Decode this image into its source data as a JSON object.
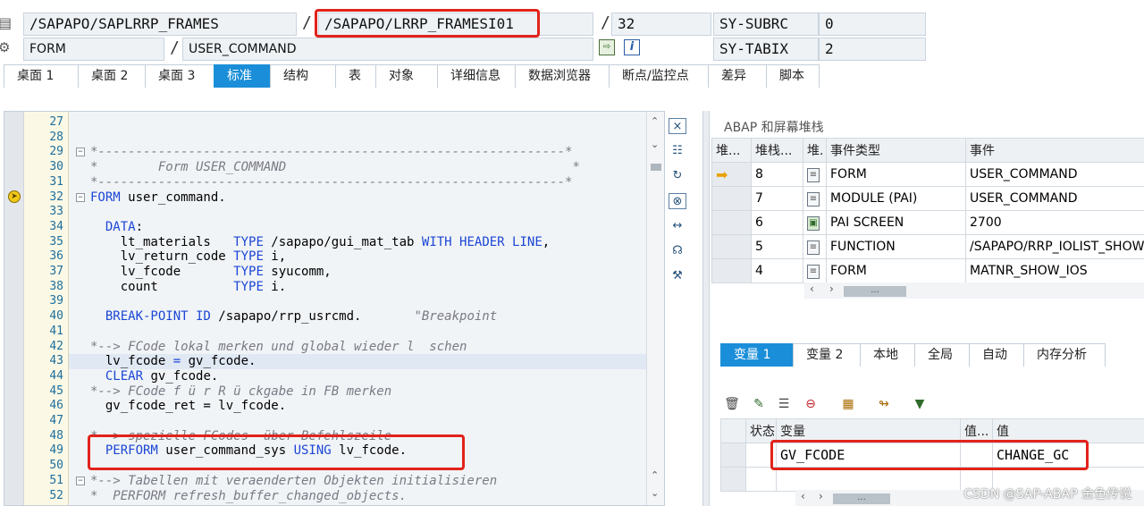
{
  "header": {
    "program": "/SAPAPO/SAPLRRP_FRAMES",
    "include": "/SAPAPO/LRRP_FRAMESI01",
    "line": "32",
    "subrc_label": "SY-SUBRC",
    "subrc_value": "0",
    "event_type": "FORM",
    "event": "USER_COMMAND",
    "tabix_label": "SY-TABIX",
    "tabix_value": "2",
    "separator": "/"
  },
  "tabs": [
    "桌面 1",
    "桌面 2",
    "桌面 3",
    "标准",
    "结构",
    "表",
    "对象",
    "详细信息",
    "数据浏览器",
    "断点/监控点",
    "差异",
    "脚本"
  ],
  "active_tab": 3,
  "code": [
    {
      "no": "27",
      "segs": []
    },
    {
      "no": "28",
      "segs": []
    },
    {
      "no": "29",
      "fold": "−",
      "segs": [
        {
          "c": "cm",
          "t": "*--------------------------------------------------------------*"
        }
      ]
    },
    {
      "no": "30",
      "segs": [
        {
          "c": "cm",
          "t": "*        Form USER_COMMAND                                      *"
        }
      ]
    },
    {
      "no": "31",
      "segs": [
        {
          "c": "cm",
          "t": "*--------------------------------------------------------------*"
        }
      ]
    },
    {
      "no": "32",
      "fold": "−",
      "segs": [
        {
          "c": "kw",
          "t": "FORM"
        },
        {
          "c": "",
          "t": " user_command."
        }
      ]
    },
    {
      "no": "33",
      "segs": []
    },
    {
      "no": "34",
      "segs": [
        {
          "c": "kw",
          "t": "  DATA"
        },
        {
          "c": "",
          "t": ":"
        }
      ]
    },
    {
      "no": "35",
      "segs": [
        {
          "c": "",
          "t": "    lt_materials   "
        },
        {
          "c": "kw",
          "t": "TYPE"
        },
        {
          "c": "",
          "t": " /sapapo/gui_mat_tab "
        },
        {
          "c": "kw",
          "t": "WITH HEADER LINE"
        },
        {
          "c": "",
          "t": ","
        }
      ]
    },
    {
      "no": "36",
      "segs": [
        {
          "c": "",
          "t": "    lv_return_code "
        },
        {
          "c": "kw",
          "t": "TYPE"
        },
        {
          "c": "",
          "t": " i,"
        }
      ]
    },
    {
      "no": "37",
      "segs": [
        {
          "c": "",
          "t": "    lv_fcode       "
        },
        {
          "c": "kw",
          "t": "TYPE"
        },
        {
          "c": "",
          "t": " syucomm,"
        }
      ]
    },
    {
      "no": "38",
      "segs": [
        {
          "c": "",
          "t": "    count          "
        },
        {
          "c": "kw",
          "t": "TYPE"
        },
        {
          "c": "",
          "t": " i."
        }
      ]
    },
    {
      "no": "39",
      "segs": []
    },
    {
      "no": "40",
      "segs": [
        {
          "c": "kw",
          "t": "  BREAK-POINT ID"
        },
        {
          "c": "",
          "t": " /sapapo/rrp_usrcmd.       "
        },
        {
          "c": "str",
          "t": "\"Breakpoint"
        }
      ]
    },
    {
      "no": "41",
      "segs": []
    },
    {
      "no": "42",
      "segs": [
        {
          "c": "cm",
          "t": "*--> FCode lokal merken und global wieder l  schen"
        }
      ]
    },
    {
      "no": "43",
      "hl": true,
      "segs": [
        {
          "c": "",
          "t": "  lv_fcode "
        },
        {
          "c": "kw",
          "t": "="
        },
        {
          "c": "",
          "t": " gv_fcode."
        }
      ]
    },
    {
      "no": "44",
      "segs": [
        {
          "c": "kw",
          "t": "  CLEAR"
        },
        {
          "c": "",
          "t": " gv_fcode."
        }
      ]
    },
    {
      "no": "45",
      "segs": [
        {
          "c": "cm",
          "t": "*--> FCode f ü r R ü ckgabe in FB merken"
        }
      ]
    },
    {
      "no": "46",
      "segs": [
        {
          "c": "",
          "t": "  gv_fcode_ret = lv_fcode."
        }
      ]
    },
    {
      "no": "47",
      "segs": []
    },
    {
      "no": "48",
      "segs": [
        {
          "c": "cm",
          "t": "*--> spezielle FCodes  über Befehlszeile"
        }
      ]
    },
    {
      "no": "49",
      "segs": [
        {
          "c": "kw",
          "t": "  PERFORM"
        },
        {
          "c": "",
          "t": " user_command_sys "
        },
        {
          "c": "kw",
          "t": "USING"
        },
        {
          "c": "",
          "t": " lv_fcode."
        }
      ]
    },
    {
      "no": "50",
      "segs": []
    },
    {
      "no": "51",
      "fold": "−",
      "segs": [
        {
          "c": "cm",
          "t": "*--> Tabellen mit veraenderten Objekten initialisieren"
        }
      ]
    },
    {
      "no": "52",
      "segs": [
        {
          "c": "cm",
          "t": "*  PERFORM refresh_buffer_changed_objects."
        }
      ]
    }
  ],
  "stack": {
    "title": "ABAP 和屏幕堆栈",
    "columns": [
      "堆...",
      "堆栈...",
      "堆.",
      "事件类型",
      "事件"
    ],
    "rows": [
      {
        "current": true,
        "level": "8",
        "icon": "form-icon",
        "type": "FORM",
        "event": "USER_COMMAND"
      },
      {
        "current": false,
        "level": "7",
        "icon": "form-icon",
        "type": "MODULE (PAI)",
        "event": "USER_COMMAND"
      },
      {
        "current": false,
        "level": "6",
        "icon": "screen-icon",
        "type": "PAI SCREEN",
        "event": "2700"
      },
      {
        "current": false,
        "level": "5",
        "icon": "form-icon",
        "type": "FUNCTION",
        "event": "/SAPAPO/RRP_IOLIST_SHOW"
      },
      {
        "current": false,
        "level": "4",
        "icon": "form-icon",
        "type": "FORM",
        "event": "MATNR_SHOW_IOS"
      }
    ]
  },
  "var_tabs": [
    "变量 1",
    "变量 2",
    "本地",
    "全局",
    "自动",
    "内存分析"
  ],
  "var_active": 0,
  "vars": {
    "columns": [
      "状态",
      "变量",
      "值...",
      "值"
    ],
    "rows": [
      {
        "name": "GV_FCODE",
        "value": "CHANGE_GC"
      },
      {
        "name": "",
        "value": ""
      }
    ]
  },
  "scroll_thumb": "...",
  "watermark": "CSDN @SAP-ABAP 金色传说",
  "colors": {
    "accent": "#1a8ed8",
    "highlight_box": "#e2231a",
    "keyword": "#1b46d6",
    "comment": "#7a7a86"
  }
}
